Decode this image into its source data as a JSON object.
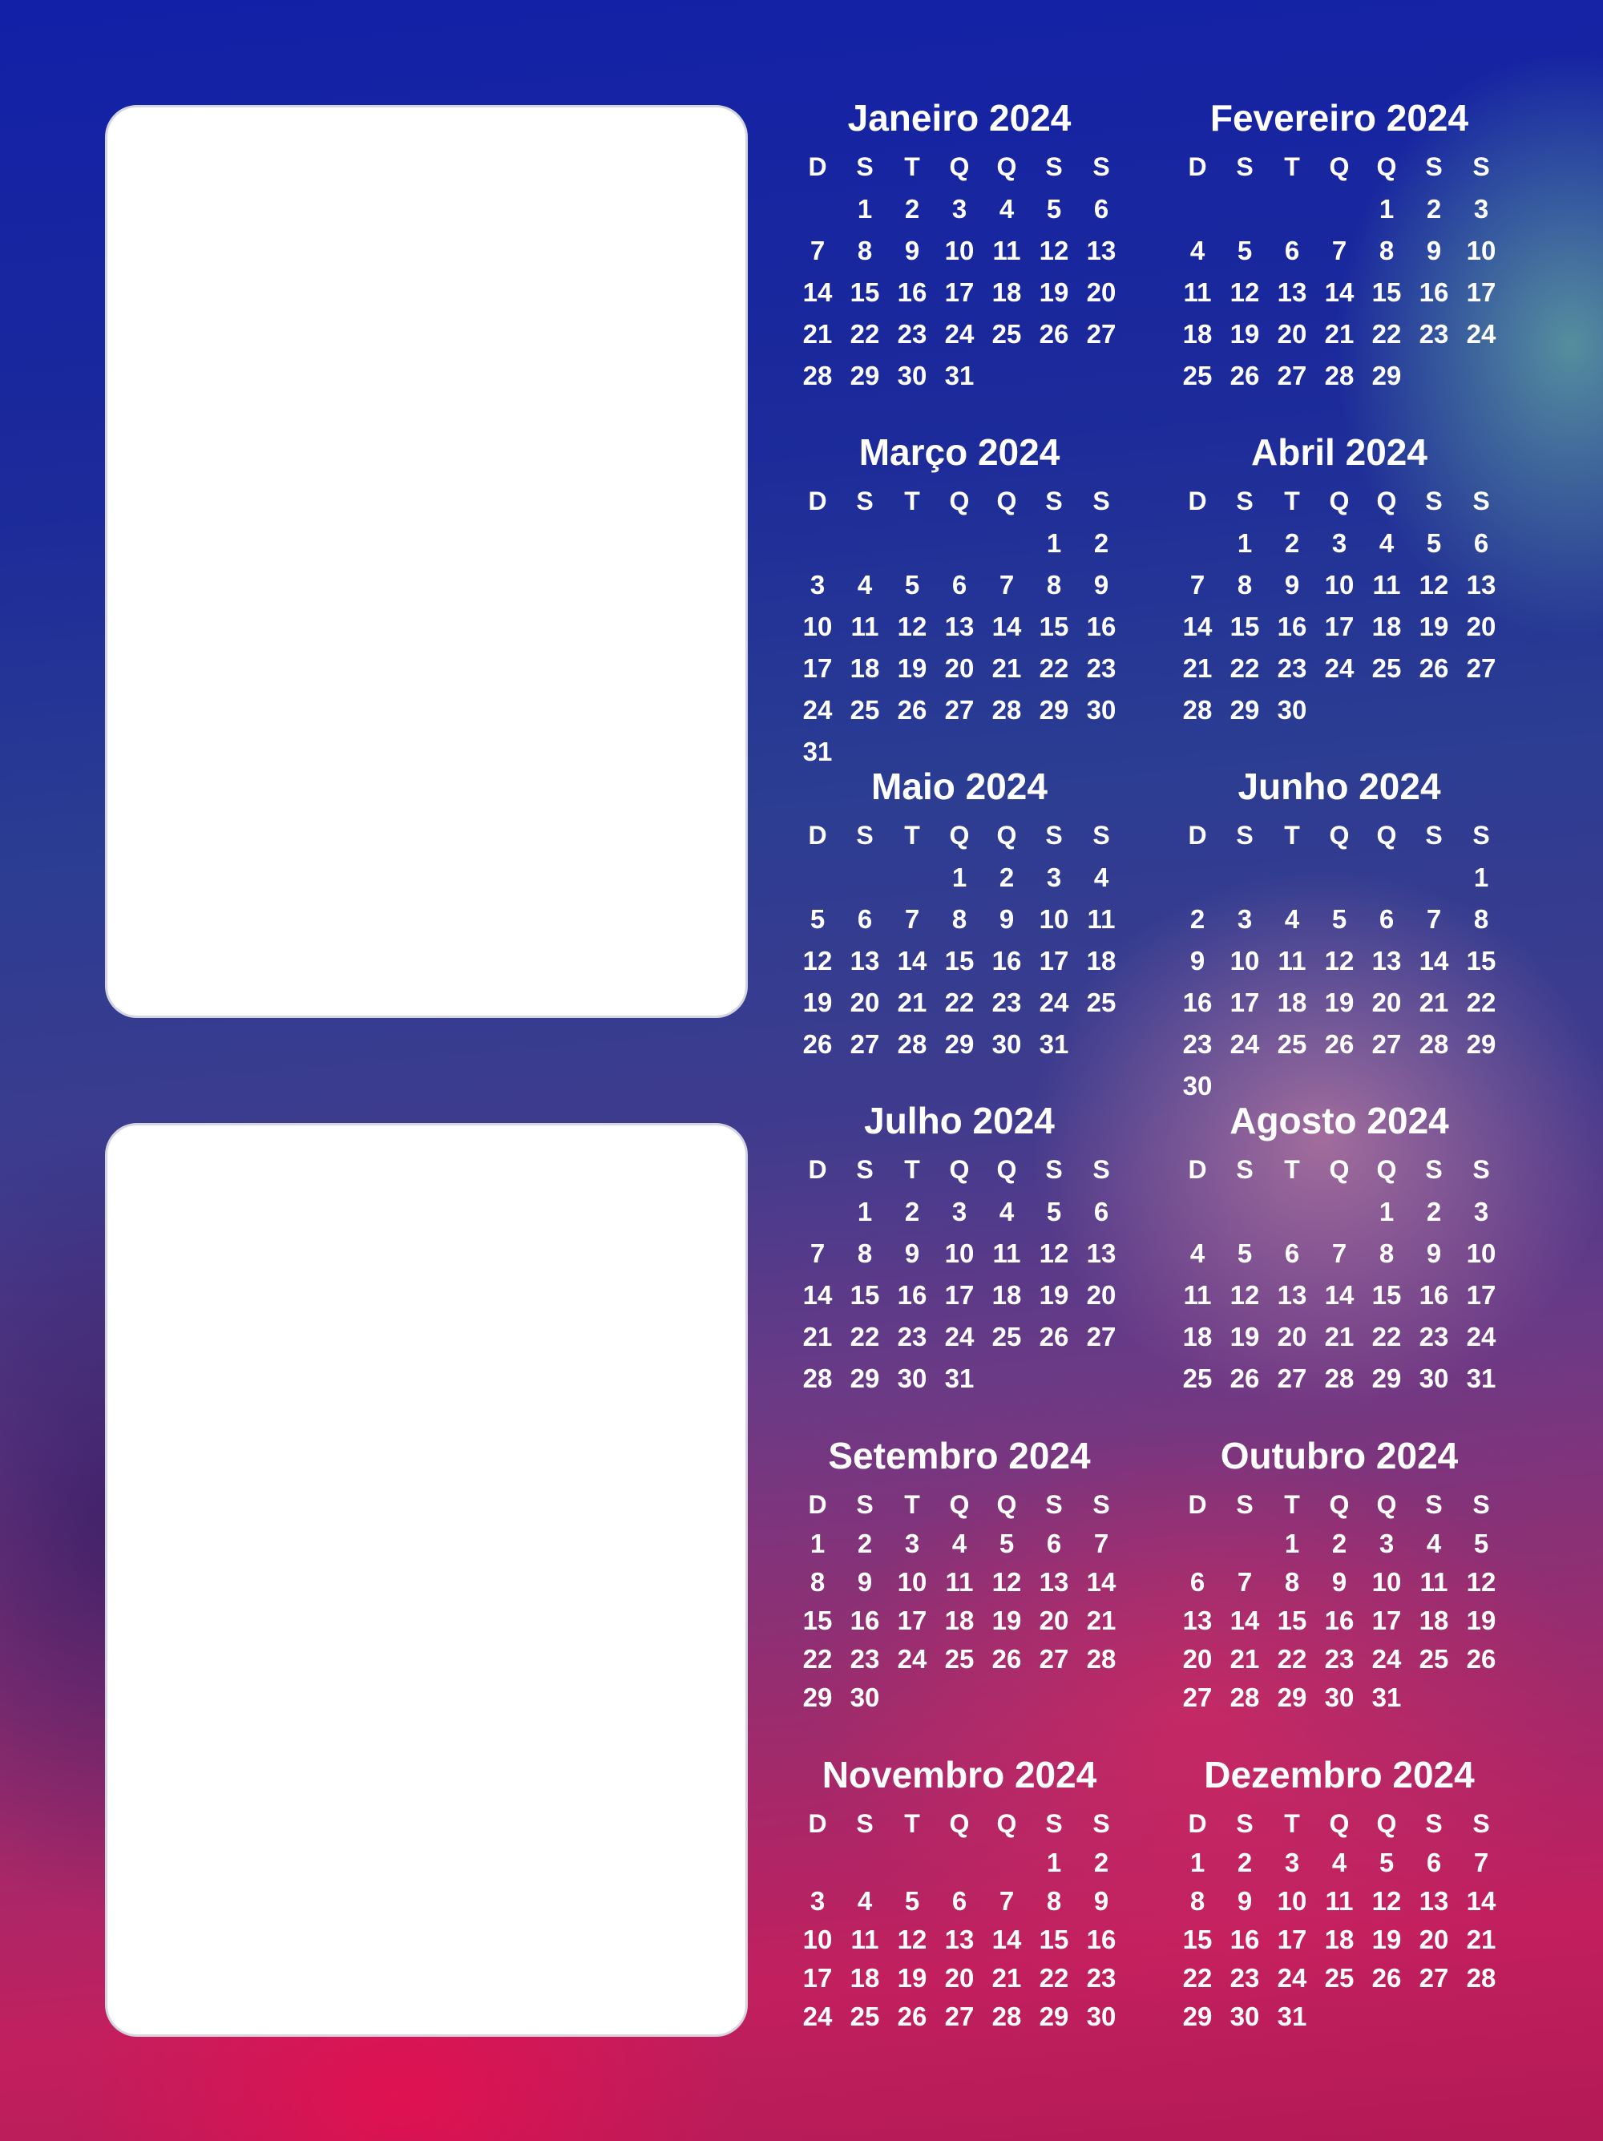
{
  "year": 2024,
  "weekdays": [
    "D",
    "S",
    "T",
    "Q",
    "Q",
    "S",
    "S"
  ],
  "months": [
    {
      "title": "Janeiro 2024",
      "first_weekday": 1,
      "days": 31
    },
    {
      "title": "Fevereiro 2024",
      "first_weekday": 4,
      "days": 29
    },
    {
      "title": "Março 2024",
      "first_weekday": 5,
      "days": 31
    },
    {
      "title": "Abril 2024",
      "first_weekday": 1,
      "days": 30
    },
    {
      "title": "Maio 2024",
      "first_weekday": 3,
      "days": 31
    },
    {
      "title": "Junho 2024",
      "first_weekday": 6,
      "days": 30
    },
    {
      "title": "Julho 2024",
      "first_weekday": 1,
      "days": 31
    },
    {
      "title": "Agosto 2024",
      "first_weekday": 4,
      "days": 31
    },
    {
      "title": "Setembro 2024",
      "first_weekday": 0,
      "days": 30
    },
    {
      "title": "Outubro 2024",
      "first_weekday": 2,
      "days": 31
    },
    {
      "title": "Novembro 2024",
      "first_weekday": 5,
      "days": 30
    },
    {
      "title": "Dezembro 2024",
      "first_weekday": 0,
      "days": 31
    }
  ]
}
